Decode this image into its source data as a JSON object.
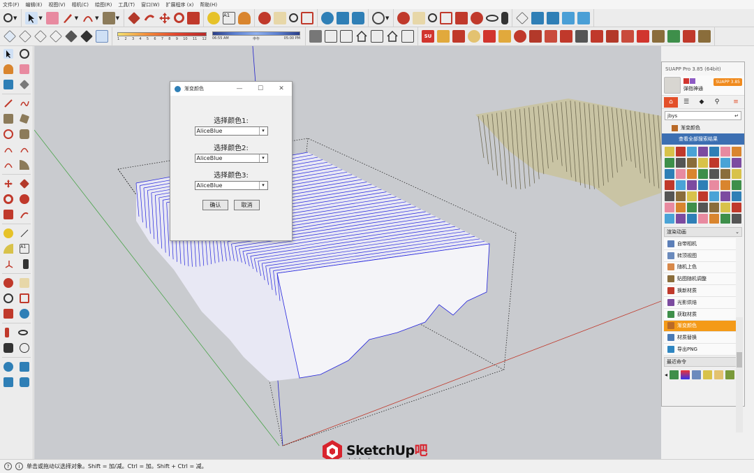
{
  "menu": [
    "文件(F)",
    "编辑(E)",
    "视图(V)",
    "相机(C)",
    "绘图(R)",
    "工具(T)",
    "窗口(W)",
    "扩展程序 (x)",
    "帮助(H)"
  ],
  "shadow_slider": {
    "ticks": [
      "1",
      "2",
      "3",
      "4",
      "5",
      "6",
      "7",
      "8",
      "9",
      "10",
      "11",
      "12"
    ]
  },
  "time_slider": {
    "start": "06:55 AM",
    "mid": "中午",
    "end": "05:00 PM"
  },
  "dialog": {
    "title": "渐变颜色",
    "color1_label": "选择颜色1:",
    "color1_value": "AliceBlue",
    "color2_label": "选择颜色2:",
    "color2_value": "AliceBlue",
    "color3_label": "选择颜色3:",
    "color3_value": "AliceBlue",
    "confirm_label": "确认",
    "cancel_label": "取消",
    "minimize": "—",
    "maximize": "☐",
    "close": "✕"
  },
  "panel": {
    "title": "SUAPP Pro 3.85 (64bit)",
    "user_name": "弹指神通",
    "badge": "SUAPP 3.85",
    "search_value": "jbys",
    "search_result": "渐变颜色",
    "view_all": "查看全部搜索结果",
    "section1": "渲染动画",
    "list": [
      {
        "label": "自带相机",
        "color": "#5c7fb8"
      },
      {
        "label": "转顶视图",
        "color": "#6b8bbd"
      },
      {
        "label": "随机上色",
        "color": "#d8894a"
      },
      {
        "label": "贴图随机调整",
        "color": "#8a6d3b"
      },
      {
        "label": "换新材质",
        "color": "#c0392b"
      },
      {
        "label": "光影烘焙",
        "color": "#7c4ba0"
      },
      {
        "label": "获取材质",
        "color": "#3e8f4a"
      },
      {
        "label": "渐变颜色",
        "color": "#b96a28"
      },
      {
        "label": "材质替换",
        "color": "#4a7ab5"
      },
      {
        "label": "导出PNG",
        "color": "#2e86c1"
      }
    ],
    "section2": "最近命令"
  },
  "status": {
    "text": "单击或拖动以选择对象。Shift = 加/减。Ctrl = 加。Shift + Ctrl = 减。",
    "info": "i",
    "help": "?"
  },
  "watermark": {
    "main": "SketchUp",
    "accent": "吧",
    "sub": "sketchupbar.com"
  },
  "colors": {
    "accent_orange": "#f49a18",
    "highlight_blue": "#3c6fb2",
    "model_blue": "#2222dd",
    "model_beige": "#c9c4a4"
  }
}
